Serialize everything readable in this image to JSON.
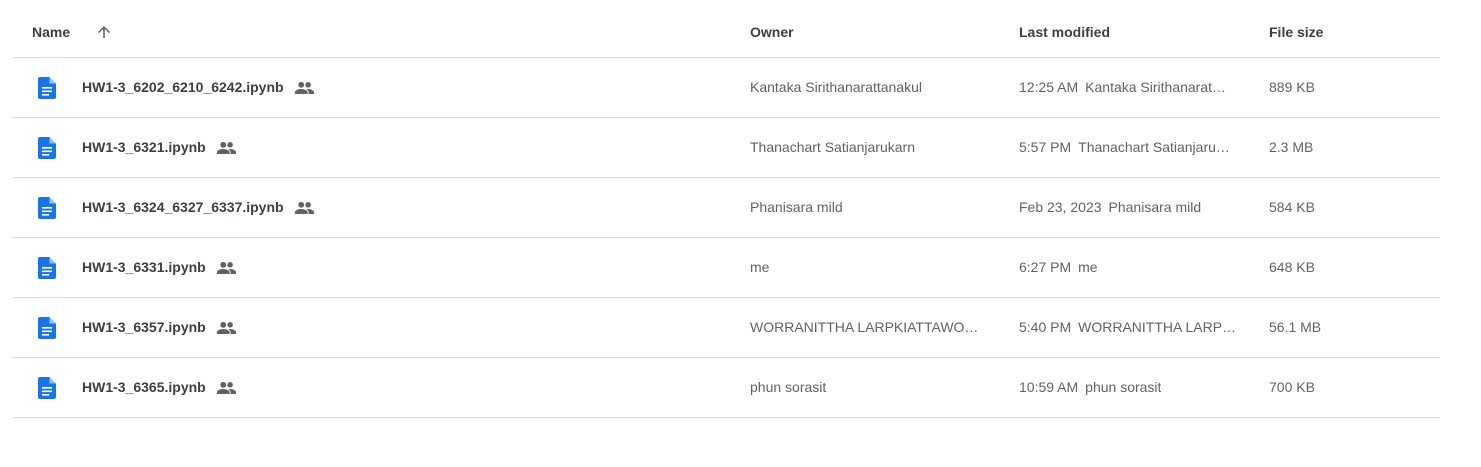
{
  "header": {
    "name": "Name",
    "owner": "Owner",
    "last_modified": "Last modified",
    "file_size": "File size",
    "sort_icon": "arrow-up-icon"
  },
  "colors": {
    "doc_icon": "#1a73e8",
    "shared_icon": "#5f6368",
    "divider": "#dadce0"
  },
  "rows": [
    {
      "name": "HW1-3_6202_6210_6242.ipynb",
      "owner": "Kantaka Sirithanarattanakul",
      "time": "12:25 AM",
      "by": "Kantaka Sirithanarat…",
      "size": "889 KB"
    },
    {
      "name": "HW1-3_6321.ipynb",
      "owner": "Thanachart Satianjarukarn",
      "time": "5:57 PM",
      "by": "Thanachart Satianjaru…",
      "size": "2.3 MB"
    },
    {
      "name": "HW1-3_6324_6327_6337.ipynb",
      "owner": "Phanisara mild",
      "time": "Feb 23, 2023",
      "by": "Phanisara mild",
      "size": "584 KB"
    },
    {
      "name": "HW1-3_6331.ipynb",
      "owner": "me",
      "time": "6:27 PM",
      "by": "me",
      "size": "648 KB"
    },
    {
      "name": "HW1-3_6357.ipynb",
      "owner": "WORRANITTHA LARPKIATTAWO…",
      "time": "5:40 PM",
      "by": "WORRANITTHA LARP…",
      "size": "56.1 MB"
    },
    {
      "name": "HW1-3_6365.ipynb",
      "owner": "phun sorasit",
      "time": "10:59 AM",
      "by": "phun sorasit",
      "size": "700 KB"
    }
  ]
}
